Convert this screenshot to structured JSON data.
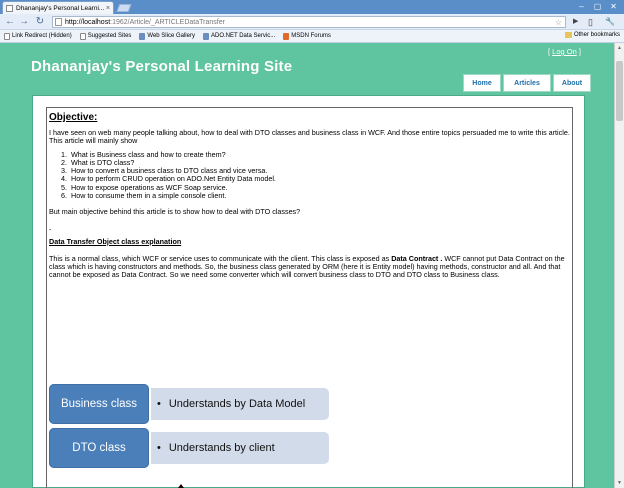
{
  "browser": {
    "tab_title": "Dhananjay's Personal Learni...",
    "tab_close": "×",
    "url_host": "http://localhost",
    "url_rest": ":1962/Article/_ARTICLEDataTransfer",
    "back": "←",
    "forward": "→",
    "reload": "↻",
    "star": "☆",
    "go": "▶",
    "page_menu": "▯",
    "tools_menu": "🔧",
    "win_min": "–",
    "win_max": "▢",
    "win_close": "✕"
  },
  "bookmarks": {
    "items": [
      {
        "label": "Link Redirect (Hidden)",
        "icon": "doc"
      },
      {
        "label": "Suggested Sites",
        "icon": "doc"
      },
      {
        "label": "Web Slice Gallery",
        "icon": "web"
      },
      {
        "label": "ADO.NET Data Servic...",
        "icon": "web"
      },
      {
        "label": "MSDN Forums",
        "icon": "msdn"
      }
    ],
    "other": "Other bookmarks"
  },
  "site": {
    "login_open": "[ ",
    "login_link": "Log On",
    "login_close": " ]",
    "title": "Dhananjay's Personal Learning Site",
    "menu": [
      {
        "label": "Home"
      },
      {
        "label": "Articles"
      },
      {
        "label": "About"
      }
    ]
  },
  "article": {
    "heading": "Objective:",
    "intro": "I have seen on web many people talking about, how to deal with DTO classes and business class in WCF. And those entire topics persuaded me to write this article.  This article will mainly show",
    "steps": [
      "What is Business class and how to create them?",
      "What is DTO class?",
      "How to convert a business class to DTO class and vice versa.",
      "How to perform CRUD operation on ADO.Net Entity Data model.",
      "How to expose operations as WCF Soap service.",
      "How to consume them in a simple console client."
    ],
    "main_objective": "But main objective behind this article is to show how to deal with DTO classes?",
    "dash": "-",
    "section_heading": "Data Transfer Object class explanation",
    "body_before": "This is a normal class, which WCF or service uses to communicate with the client.  This class is exposed as ",
    "body_bold": "Data Contract .",
    "body_after": " WCF cannot put Data Contract on the class which is having constructors and methods.  So, the business class generated by ORM (here it is Entity model) having methods, constructor and all. And that cannot be exposed as Data Contract.  So we need some converter which will convert business class to DTO and DTO class to Business class.",
    "diagram": [
      {
        "label": "Business class",
        "text": "Understands by Data Model"
      },
      {
        "label": "DTO class",
        "text": "Understands by client"
      }
    ],
    "bullet": "•"
  }
}
